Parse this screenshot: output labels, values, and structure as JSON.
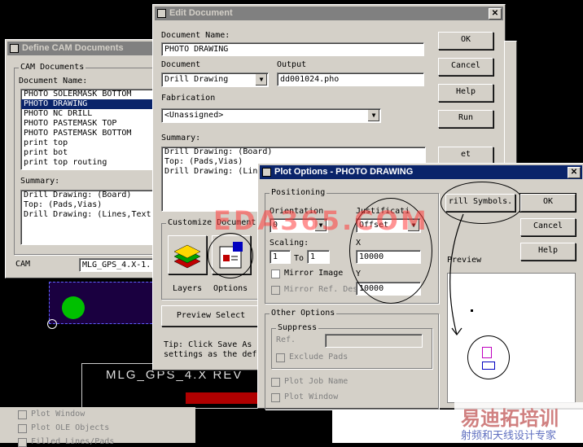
{
  "cam_window": {
    "title": "Define CAM Documents",
    "group_label": "CAM Documents",
    "doc_name_label": "Document Name:",
    "documents": [
      "PHOTO SOLERMASK BOTTOM",
      "PHOTO DRAWING",
      "PHOTO NC DRILL",
      "PHOTO PASTEMASK TOP",
      "PHOTO PASTEMASK BOTTOM",
      "print top",
      "print bot",
      "print top routing"
    ],
    "selected_document": "PHOTO DRAWING",
    "summary_label": "Summary:",
    "summary_lines": [
      "Drill Drawing: (Board)",
      "Top: (Pads,Vias)",
      "Drill Drawing: (Lines,Text"
    ],
    "cam_label": "CAM",
    "cam_value": "MLG_GPS_4.X-1."
  },
  "edit_window": {
    "title": "Edit Document",
    "doc_name_label": "Document Name:",
    "doc_name_value": "PHOTO DRAWING",
    "document_label": "Document",
    "document_value": "Drill Drawing",
    "output_label": "Output",
    "output_value": "dd001024.pho",
    "fabrication_label": "Fabrication",
    "fabrication_value": "<Unassigned>",
    "summary_label": "Summary:",
    "summary_lines": [
      "Drill Drawing: (Board)",
      "Top: (Pads,Vias)",
      "Drill Drawing: (Lin"
    ],
    "customize_label": "Customize Document",
    "layers_label": "Layers",
    "options_label": "Options",
    "preview_button": "Preview Select",
    "tip_lines": [
      "Tip: Click Save As",
      "settings as the def"
    ],
    "ok": "OK",
    "cancel": "Cancel",
    "help": "Help",
    "run": "Run",
    "set_layers": "et Layers.."
  },
  "plot_window": {
    "title": "Plot Options - PHOTO DRAWING",
    "positioning_label": "Positioning",
    "orientation_label": "Orientation",
    "orientation_value": "0",
    "justification_label": "Justificati",
    "justification_value": "Offset",
    "scaling_label": "Scaling:",
    "scale_from": "1",
    "to_label": "To",
    "scale_to": "1",
    "x_label": "X",
    "x_value": "10000",
    "y_label": "Y",
    "y_value": "10000",
    "mirror_image": "Mirror Image",
    "mirror_ref": "Mirror Ref. Des",
    "other_options_label": "Other Options",
    "suppress_label": "Suppress",
    "ref_label": "Ref.",
    "exclude_pads": "Exclude Pads",
    "plot_job_name": "Plot Job Name",
    "plot_window": "Plot Window",
    "drill_symbols": "rill Symbols.",
    "ok": "OK",
    "cancel": "Cancel",
    "help": "Help",
    "preview_label": "Preview"
  },
  "background_checks": [
    "Plot Window",
    "Plot OLE Objects",
    "Filled Lines/Pads"
  ],
  "pcb_text": "MLG_GPS_4.X  REV",
  "watermark_top": "EDA365.COM",
  "watermark_bottom_cn": "易迪拓培训",
  "watermark_bottom_sub": "射频和天线设计专家"
}
